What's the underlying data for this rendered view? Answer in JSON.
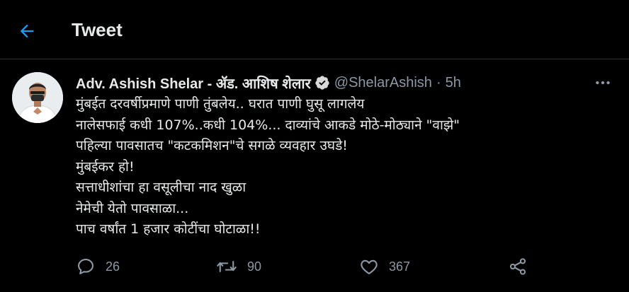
{
  "header": {
    "title": "Tweet"
  },
  "tweet": {
    "display_name": "Adv. Ashish Shelar - ॲड. आशिष शेलार",
    "handle": "@ShelarAshish",
    "separator": "·",
    "time": "5h",
    "lines": [
      "मुंबईत दरवर्षीप्रमाणे पाणी तुंबलेय.. घरात पाणी घुसू लागलेय",
      "नालेसफाई कधी 107%..कधी 104%... दाव्यांचे आकडे मोठे-मोठ्याने \"वाझे\"",
      "पहिल्या पावसातच \"कटकमिशन\"चे सगळे व्यवहार उघडे!",
      "मुंबईकर हो!",
      "सत्ताधीशांचा हा वसूलीचा नाद खुळा",
      "नेमेची येतो पावसाळा...",
      "पाच वर्षांत 1 हजार कोटींचा घोटाळा!!"
    ],
    "counts": {
      "replies": "26",
      "retweets": "90",
      "likes": "367"
    }
  },
  "colors": {
    "background": "#000000",
    "accent": "#1d9bf0",
    "text": "#e7e9ea",
    "secondary": "#8b98a5",
    "divider": "#2f3336"
  },
  "icons": {
    "back": "arrow-left-icon",
    "verified": "verified-badge-icon",
    "more": "more-horizontal-icon",
    "reply": "reply-icon",
    "retweet": "retweet-icon",
    "like": "heart-icon",
    "share": "share-icon"
  }
}
